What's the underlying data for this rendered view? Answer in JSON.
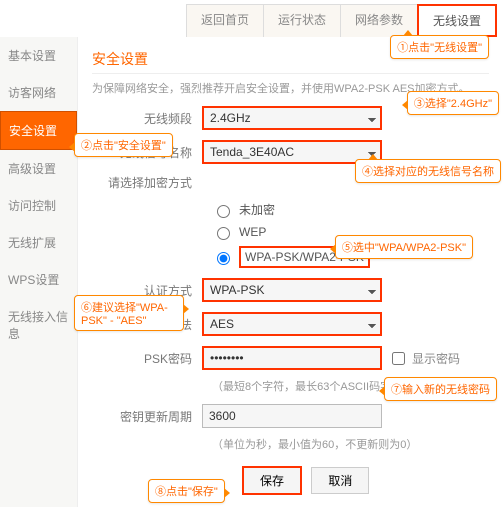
{
  "topnav": {
    "tabs": [
      "返回首页",
      "运行状态",
      "网络参数",
      "无线设置"
    ],
    "active": 3
  },
  "sidebar": {
    "items": [
      "基本设置",
      "访客网络",
      "安全设置",
      "高级设置",
      "访问控制",
      "无线扩展",
      "WPS设置",
      "无线接入信息"
    ],
    "active": 2
  },
  "title": "安全设置",
  "note": "为保障网络安全，强烈推荐开启安全设置，并使用WPA2-PSK AES加密方式。",
  "fields": {
    "band_label": "无线频段",
    "band_value": "2.4GHz",
    "ssid_label": "无线信号名称",
    "ssid_value": "Tenda_3E40AC",
    "enc_label": "请选择加密方式",
    "enc_options": {
      "none": "未加密",
      "wep": "WEP",
      "wpa": "WPA-PSK/WPA2-PSK"
    },
    "auth_label": "认证方式",
    "auth_value": "WPA-PSK",
    "cipher_label": "加密算法",
    "cipher_value": "AES",
    "psk_label": "PSK密码",
    "psk_value": "••••••••",
    "showpwd": "显示密码",
    "psk_hint": "（最短8个字符，最长63个ASCII码字符）",
    "rekey_label": "密钥更新周期",
    "rekey_value": "3600",
    "rekey_hint": "（单位为秒，最小值为60，不更新则为0）"
  },
  "buttons": {
    "save": "保存",
    "cancel": "取消"
  },
  "callouts": {
    "c1": "①点击\"无线设置\"",
    "c2": "②点击\"安全设置\"",
    "c3": "③选择\"2.4GHz\"",
    "c4": "④选择对应的无线信号名称",
    "c5": "⑤选中\"WPA/WPA2-PSK\"",
    "c6": "⑥建议选择\"WPA-PSK\" - \"AES\"",
    "c7": "⑦输入新的无线密码",
    "c8": "⑧点击\"保存\""
  }
}
